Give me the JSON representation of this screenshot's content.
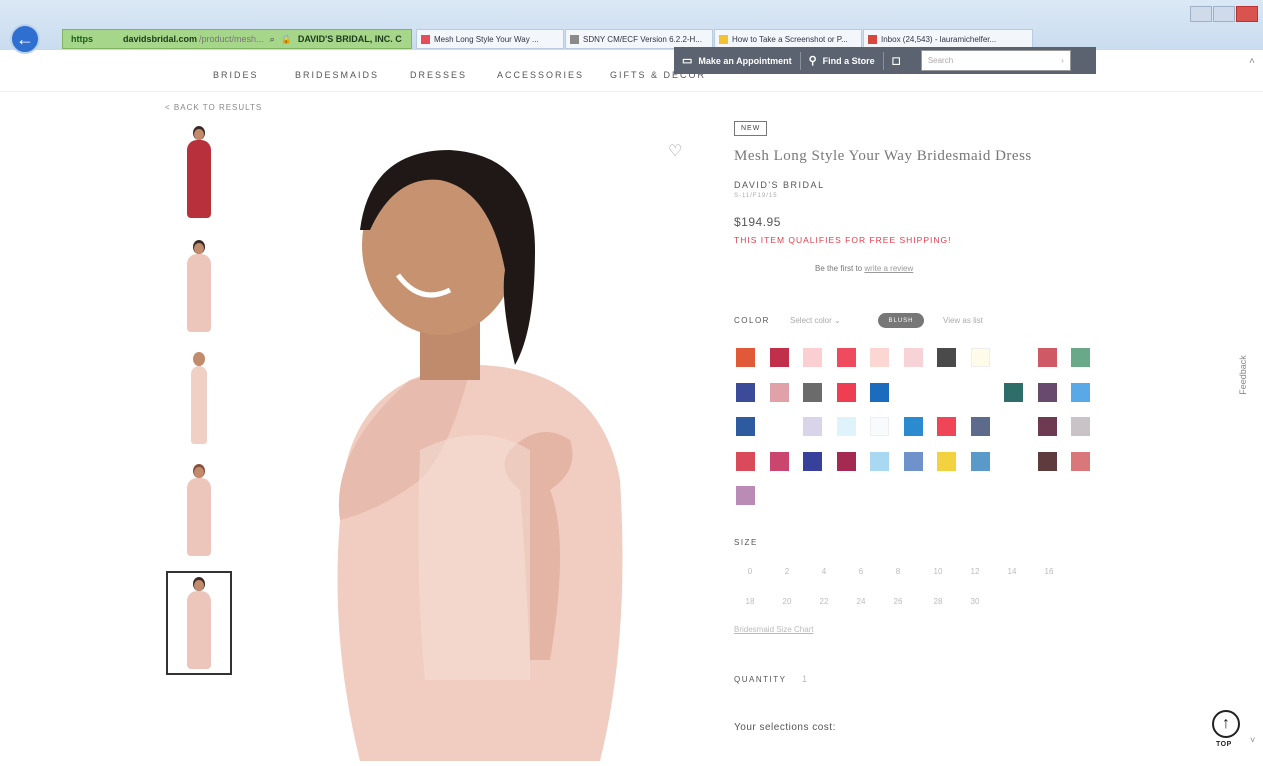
{
  "browser": {
    "address_proto": "https",
    "address_host": "davidsbridal.com",
    "address_path": "/product/mesh...",
    "address_org": "DAVID'S BRIDAL, INC. C",
    "tabs": [
      "Mesh Long Style Your Way ...",
      "SDNY CM/ECF Version 6.2.2-H...",
      "How to Take a Screenshot or P...",
      "Inbox (24,543) - lauramichelfer..."
    ]
  },
  "nav": {
    "items": [
      "BRIDES",
      "BRIDESMAIDS",
      "DRESSES",
      "ACCESSORIES",
      "GIFTS & DECOR"
    ],
    "appointment": "Make an Appointment",
    "find_store": "Find a Store",
    "search_placeholder": "Search"
  },
  "back_to_results": "< BACK TO RESULTS",
  "product": {
    "badge": "NEW",
    "title": "Mesh Long Style Your Way Bridesmaid Dress",
    "brand": "DAVID'S BRIDAL",
    "sku": "S-11/F19/15",
    "price": "$194.95",
    "shipping": "THIS ITEM QUALIFIES FOR FREE SHIPPING!",
    "review_prefix": "Be the first to",
    "review_link": "write a review"
  },
  "color": {
    "label": "COLOR",
    "select_placeholder": "Select color",
    "selected_pill": "BLUSH",
    "alt_link": "View as list"
  },
  "size": {
    "label": "SIZE",
    "row1": [
      "0",
      "2",
      "4",
      "6",
      "8",
      "10",
      "12",
      "14",
      "16"
    ],
    "row2": [
      "18",
      "20",
      "22",
      "24",
      "26",
      "28",
      "30"
    ],
    "guide": "Bridesmaid Size Chart"
  },
  "quantity": {
    "label": "QUANTITY",
    "value": "1"
  },
  "selections_cost": "Your selections cost:",
  "feedback": "Feedback",
  "top_label": "TOP",
  "colors": {
    "swatches": [
      [
        "#e05a3a",
        "#c0304a",
        "#fbcfd2",
        "#ef4a5e",
        "#fcd6d2",
        "#f7d2d6",
        "#4a4a4a",
        "#fffbe8",
        null,
        "#cf5a66",
        "#6aa88a"
      ],
      [
        "#3b4b99",
        "#e0a2a8",
        "#6b6b6b",
        "#ef3d52",
        "#1b6bbf",
        null,
        null,
        null,
        "#2d6e6a",
        "#674a6e",
        "#59a9e8"
      ],
      [
        "#2e5aa0",
        null,
        "#d9d4ea",
        "#dff3fa",
        "#f7fbfd",
        "#2a8ccf",
        "#ef4556",
        "#5c6a8c",
        null,
        "#6e3a52",
        "#c9c2c6"
      ],
      [
        "#d94a5a",
        "#c9466e",
        "#37409a",
        "#a52a52",
        "#a8d8f2",
        "#6e92c9",
        "#f2d23e",
        "#5a9ac9",
        null,
        "#5e3c3e",
        "#d9777a"
      ],
      [
        "#b98bb5"
      ]
    ]
  }
}
